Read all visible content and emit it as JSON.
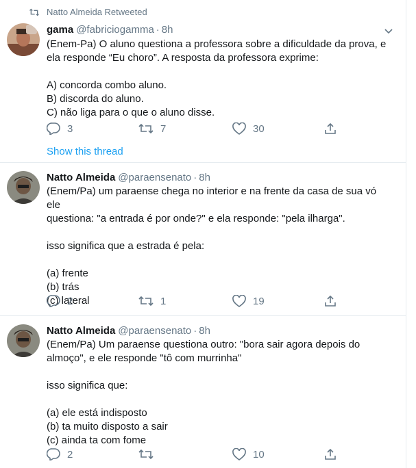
{
  "retweet_banner": "Natto Almeida Retweeted",
  "tweets": [
    {
      "name": "gama",
      "handle": "@fabriciogamma",
      "separator": "·",
      "time": "8h",
      "lines": [
        "(Enem-Pa) O aluno questiona a professora sobre a dificuldade da prova, e",
        "ela responde “Eu choro”. A resposta da professora exprime:",
        "",
        "A) concorda combo aluno.",
        "B) discorda do aluno.",
        "C) não liga para o que o aluno disse."
      ],
      "replies": "3",
      "retweets": "7",
      "likes": "30",
      "show_thread": "Show this thread"
    },
    {
      "name": "Natto Almeida",
      "handle": "@paraensenato",
      "separator": "·",
      "time": "8h",
      "lines": [
        "(Enem/Pa) um paraense chega no interior e na frente da casa de sua vó ele",
        "questiona: \"a entrada é por onde?\" e ela responde: \"pela ilharga\".",
        "",
        "isso significa que a estrada é pela:",
        "",
        "(a) frente",
        "(b) trás",
        "(c) lateral"
      ],
      "replies": "2",
      "retweets": "1",
      "likes": "19"
    },
    {
      "name": "Natto Almeida",
      "handle": "@paraensenato",
      "separator": "·",
      "time": "8h",
      "lines": [
        "(Enem/Pa) Um paraense questiona outro: \"bora sair agora depois do",
        "almoço\", e ele responde \"tô com murrinha\"",
        "",
        "isso significa que:",
        "",
        "(a) ele está indisposto",
        "(b) ta muito disposto a sair",
        "(c) ainda ta com fome"
      ],
      "replies": "2",
      "retweets": "",
      "likes": "10"
    }
  ]
}
